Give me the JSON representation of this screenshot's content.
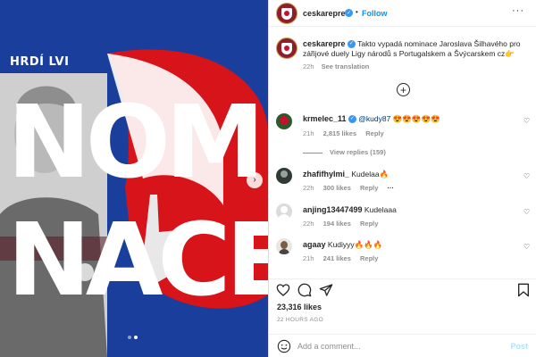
{
  "media": {
    "tag": "HRDÍ LVI",
    "word_line1": "NOMI",
    "word_line2": "NACE",
    "carousel_active_index": 1,
    "carousel_count": 2,
    "colors": {
      "blue": "#1a3e9c",
      "red": "#d7141a",
      "white": "#ffffff"
    }
  },
  "header": {
    "username": "ceskarepre",
    "verified": true,
    "separator": "•",
    "follow_label": "Follow",
    "more_label": "···"
  },
  "caption": {
    "username": "ceskarepre",
    "text": "Takto vypadá nominace Jaroslava Šilhavého pro zářijové duely Ligy národů s Portugalskem a Švýcarskem cz👉",
    "time": "22h",
    "see_translation": "See translation"
  },
  "load_more_icon": "plus-circle-icon",
  "comments": [
    {
      "username": "krmelec_11",
      "verified": true,
      "mention": "@kudy87",
      "text": " 😍😍😍😍😍",
      "time": "21h",
      "likes": "2,815 likes",
      "reply": "Reply",
      "view_replies": "View replies (159)"
    },
    {
      "username": "zhafifhylmi_",
      "text": "Kudelaa🔥",
      "time": "22h",
      "likes": "300 likes",
      "reply": "Reply",
      "more": "···"
    },
    {
      "username": "anjing13447499",
      "text": "Kudelaaa",
      "time": "22h",
      "likes": "194 likes",
      "reply": "Reply"
    },
    {
      "username": "agaay",
      "text": "Kudiyyy🔥🔥🔥",
      "time": "21h",
      "likes": "241 likes",
      "reply": "Reply"
    }
  ],
  "actions": {
    "like_icon": "heart-icon",
    "comment_icon": "comment-icon",
    "share_icon": "share-icon",
    "save_icon": "bookmark-icon"
  },
  "likes": "23,316 likes",
  "time_ago": "22 HOURS AGO",
  "add_comment": {
    "placeholder": "Add a comment...",
    "post_label": "Post",
    "emoji_icon": "smiley-icon"
  }
}
